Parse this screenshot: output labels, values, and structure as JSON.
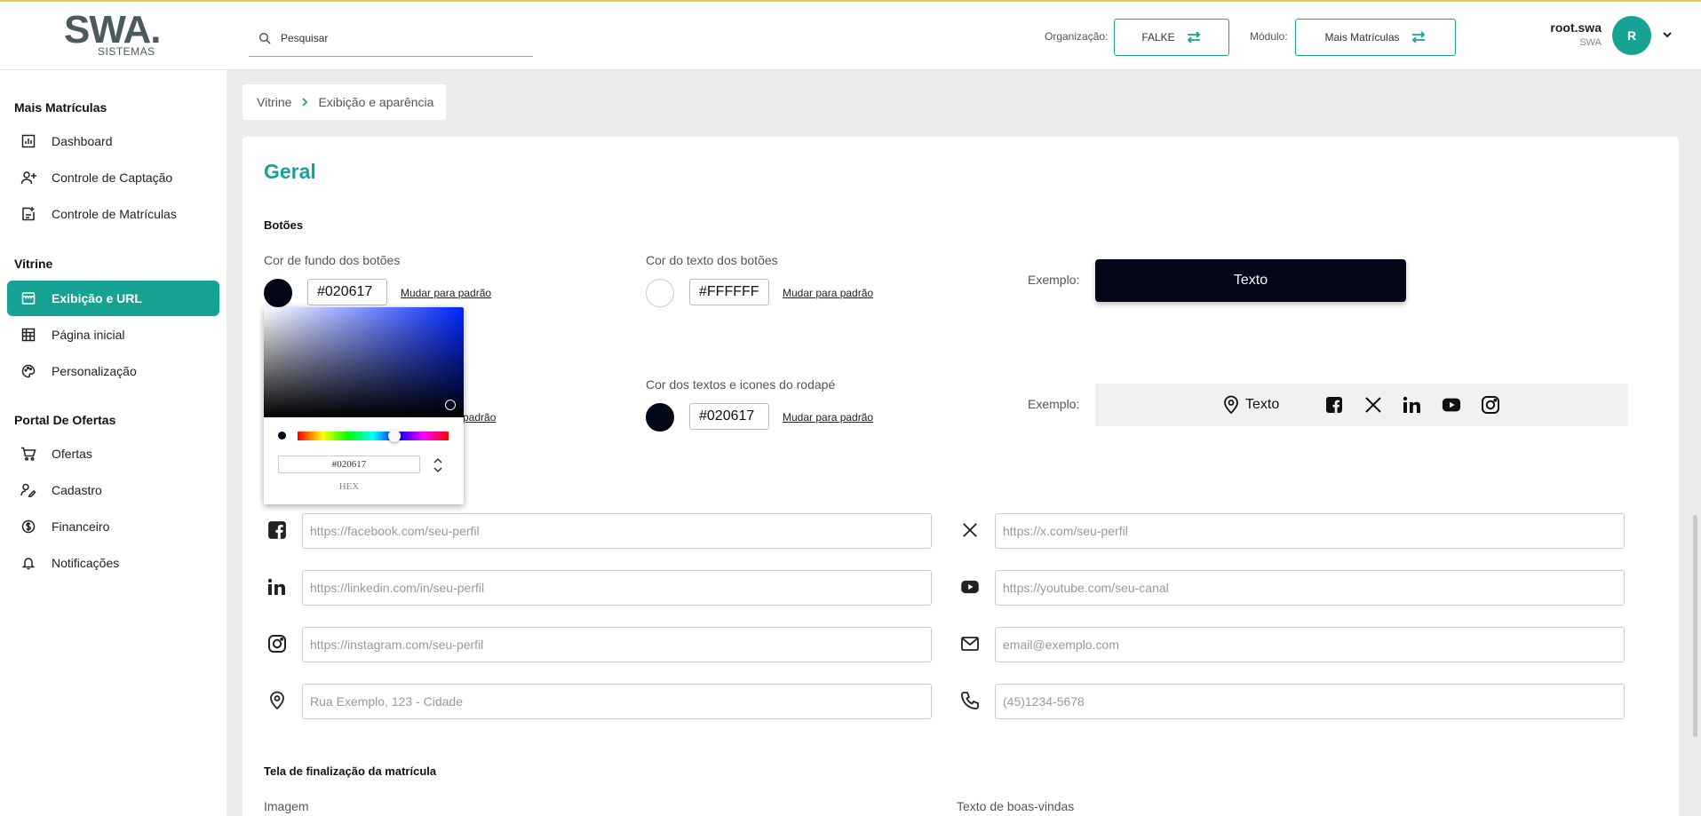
{
  "header": {
    "logo_text": "SWA.",
    "logo_sub": "SISTEMAS",
    "search_placeholder": "Pesquisar",
    "org_label": "Organização:",
    "org_value": "FALKE",
    "module_label": "Módulo:",
    "module_value": "Mais Matrículas",
    "user_name": "root.swa",
    "user_org": "SWA",
    "avatar_initial": "R",
    "accent": "#17a393"
  },
  "sidebar": {
    "sections": [
      {
        "title": "Mais Matrículas",
        "items": [
          {
            "label": "Dashboard",
            "icon": "chart-icon"
          },
          {
            "label": "Controle de Captação",
            "icon": "user-plus-icon"
          },
          {
            "label": "Controle de Matrículas",
            "icon": "doc-plus-icon"
          }
        ]
      },
      {
        "title": "Vitrine",
        "items": [
          {
            "label": "Exibição e URL",
            "icon": "store-icon",
            "active": true
          },
          {
            "label": "Página inicial",
            "icon": "grid-icon"
          },
          {
            "label": "Personalização",
            "icon": "palette-icon"
          }
        ]
      },
      {
        "title": "Portal De Ofertas",
        "items": [
          {
            "label": "Ofertas",
            "icon": "cart-icon"
          },
          {
            "label": "Cadastro",
            "icon": "user-edit-icon"
          },
          {
            "label": "Financeiro",
            "icon": "dollar-icon"
          },
          {
            "label": "Notificações",
            "icon": "bell-icon"
          }
        ]
      }
    ]
  },
  "breadcrumb": {
    "root": "Vitrine",
    "current": "Exibição e aparência"
  },
  "main": {
    "title": "Geral",
    "buttons_section": "Botões",
    "bg_label": "Cor de fundo dos botões",
    "bg_hex": "#020617",
    "reset_label": "Mudar para padrão",
    "text_label": "Cor do texto dos botões",
    "text_hex": "#FFFFFF",
    "example_label": "Exemplo:",
    "example_button_text": "Texto",
    "footer_text_label": "Cor dos textos e icones do rodapé",
    "footer_hex": "#020617",
    "footer_partial_reset": "padrão",
    "example_footer_text": "Texto",
    "picker": {
      "hex_value": "#020617",
      "mode_label": "HEX"
    },
    "social": [
      {
        "icon": "facebook-icon",
        "placeholder": "https://facebook.com/seu-perfil"
      },
      {
        "icon": "x-icon",
        "placeholder": "https://x.com/seu-perfil"
      },
      {
        "icon": "linkedin-icon",
        "placeholder": "https://linkedin.com/in/seu-perfil"
      },
      {
        "icon": "youtube-icon",
        "placeholder": "https://youtube.com/seu-canal"
      },
      {
        "icon": "instagram-icon",
        "placeholder": "https://instagram.com/seu-perfil"
      },
      {
        "icon": "mail-icon",
        "placeholder": "email@exemplo.com"
      },
      {
        "icon": "location-icon",
        "placeholder": "Rua Exemplo, 123 - Cidade"
      },
      {
        "icon": "phone-icon",
        "placeholder": "(45)1234-5678"
      }
    ],
    "finalization_section": "Tela de finalização da matrícula",
    "image_label": "Imagem",
    "welcome_label": "Texto de boas-vindas"
  }
}
